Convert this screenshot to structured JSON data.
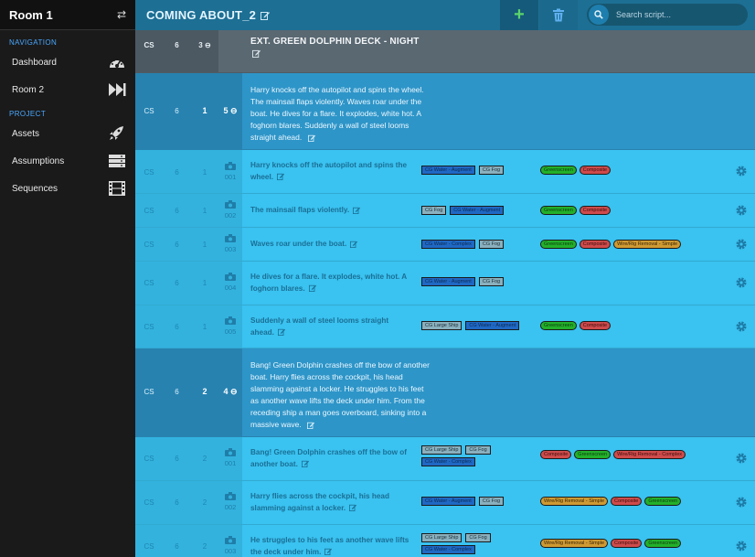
{
  "sidebar": {
    "title": "Room 1",
    "navigation_label": "NAVIGATION",
    "project_label": "PROJECT",
    "nav_items": [
      {
        "label": "Dashboard",
        "icon": "dashboard-icon"
      },
      {
        "label": "Room 2",
        "icon": "fast-forward-icon"
      }
    ],
    "project_items": [
      {
        "label": "Assets",
        "icon": "rocket-icon"
      },
      {
        "label": "Assumptions",
        "icon": "server-icon"
      },
      {
        "label": "Sequences",
        "icon": "film-icon"
      }
    ]
  },
  "topbar": {
    "title": "COMING ABOUT_2",
    "add_label": "+",
    "search_placeholder": "Search script..."
  },
  "colors": {
    "topbar": "#1d6f94",
    "scene_row": "#5a6872",
    "action_row": "#2e95c8",
    "shot_row": "#3ac2f0",
    "tag_blue": "#1f68c4",
    "tag_grey": "#8ab0be",
    "tag_green": "#23b02a",
    "tag_red": "#cf4b4b",
    "tag_orange": "#cf9a33"
  },
  "scene": {
    "cs": "CS",
    "col2": "6",
    "col3": "3",
    "heading": "EXT. GREEN DOLPHIN DECK - NIGHT"
  },
  "actions": [
    {
      "cs": "CS",
      "col2": "6",
      "col3": "1",
      "col4": "5",
      "text": "Harry knocks off the autopilot and spins the wheel. The mainsail flaps violently. Waves roar under the boat. He dives for a flare. It explodes, white hot. A foghorn blares. Suddenly a wall of steel looms straight ahead."
    },
    {
      "cs": "CS",
      "col2": "6",
      "col3": "2",
      "col4": "4",
      "text": "Bang! Green Dolphin crashes off the bow of another boat. Harry flies across the cockpit, his head slamming against a locker. He struggles to his feet as another wave lifts the deck under him. From the receding ship a man goes overboard, sinking into a massive wave."
    }
  ],
  "shots": [
    {
      "cs": "CS",
      "col2": "6",
      "col3": "1",
      "id": "001",
      "text": "Harry knocks off the autopilot and spins the wheel.",
      "assets": [
        {
          "label": "CG Water - Augment",
          "color": "blue"
        },
        {
          "label": "CG Fog",
          "color": "grey"
        }
      ],
      "assumptions": [
        {
          "label": "Greenscreen",
          "color": "green"
        },
        {
          "label": "Composite",
          "color": "red"
        }
      ]
    },
    {
      "cs": "CS",
      "col2": "6",
      "col3": "1",
      "id": "002",
      "text": "The mainsail flaps violently.",
      "assets": [
        {
          "label": "CG Fog",
          "color": "grey"
        },
        {
          "label": "CG Water - Augment",
          "color": "blue"
        }
      ],
      "assumptions": [
        {
          "label": "Greenscreen",
          "color": "green"
        },
        {
          "label": "Composite",
          "color": "red"
        }
      ]
    },
    {
      "cs": "CS",
      "col2": "6",
      "col3": "1",
      "id": "003",
      "text": "Waves roar under the boat.",
      "assets": [
        {
          "label": "CG Water - Complex",
          "color": "blue"
        },
        {
          "label": "CG Fog",
          "color": "grey"
        }
      ],
      "assumptions": [
        {
          "label": "Greenscreen",
          "color": "green"
        },
        {
          "label": "Composite",
          "color": "red"
        },
        {
          "label": "Wire/Rig Removal - Simple",
          "color": "orange"
        }
      ]
    },
    {
      "cs": "CS",
      "col2": "6",
      "col3": "1",
      "id": "004",
      "text": "He dives for a flare. It explodes, white hot. A foghorn blares.",
      "assets": [
        {
          "label": "CG Water - Augment",
          "color": "blue"
        },
        {
          "label": "CG Fog",
          "color": "grey"
        }
      ],
      "assumptions": []
    },
    {
      "cs": "CS",
      "col2": "6",
      "col3": "1",
      "id": "005",
      "text": "Suddenly a wall of steel looms straight ahead.",
      "assets": [
        {
          "label": "CG Large Ship",
          "color": "grey"
        },
        {
          "label": "CG Water - Augment",
          "color": "blue"
        }
      ],
      "assumptions": [
        {
          "label": "Greenscreen",
          "color": "green"
        },
        {
          "label": "Composite",
          "color": "red"
        }
      ]
    },
    {
      "cs": "CS",
      "col2": "6",
      "col3": "2",
      "id": "001",
      "text": "Bang! Green Dolphin crashes off the bow of another boat.",
      "assets": [
        {
          "label": "CG Large Ship",
          "color": "grey"
        },
        {
          "label": "CG Fog",
          "color": "grey"
        },
        {
          "label": "CG Water - Complex",
          "color": "blue"
        }
      ],
      "assumptions": [
        {
          "label": "Composite",
          "color": "red"
        },
        {
          "label": "Greenscreen",
          "color": "green"
        },
        {
          "label": "Wire/Rig Removal - Complex",
          "color": "red"
        }
      ]
    },
    {
      "cs": "CS",
      "col2": "6",
      "col3": "2",
      "id": "002",
      "text": "Harry flies across the cockpit, his head slamming against a locker.",
      "assets": [
        {
          "label": "CG Water - Augment",
          "color": "blue"
        },
        {
          "label": "CG Fog",
          "color": "grey"
        }
      ],
      "assumptions": [
        {
          "label": "Wire/Rig Removal - Simple",
          "color": "orange"
        },
        {
          "label": "Composite",
          "color": "red"
        },
        {
          "label": "Greenscreen",
          "color": "green"
        }
      ]
    },
    {
      "cs": "CS",
      "col2": "6",
      "col3": "2",
      "id": "003",
      "text": "He struggles to his feet as another wave lifts the deck under him.",
      "assets": [
        {
          "label": "CG Large Ship",
          "color": "grey"
        },
        {
          "label": "CG Fog",
          "color": "grey"
        },
        {
          "label": "CG Water - Complex",
          "color": "blue"
        }
      ],
      "assumptions": [
        {
          "label": "Wire/Rig Removal - Simple",
          "color": "orange"
        },
        {
          "label": "Composite",
          "color": "red"
        },
        {
          "label": "Greenscreen",
          "color": "green"
        }
      ]
    }
  ]
}
